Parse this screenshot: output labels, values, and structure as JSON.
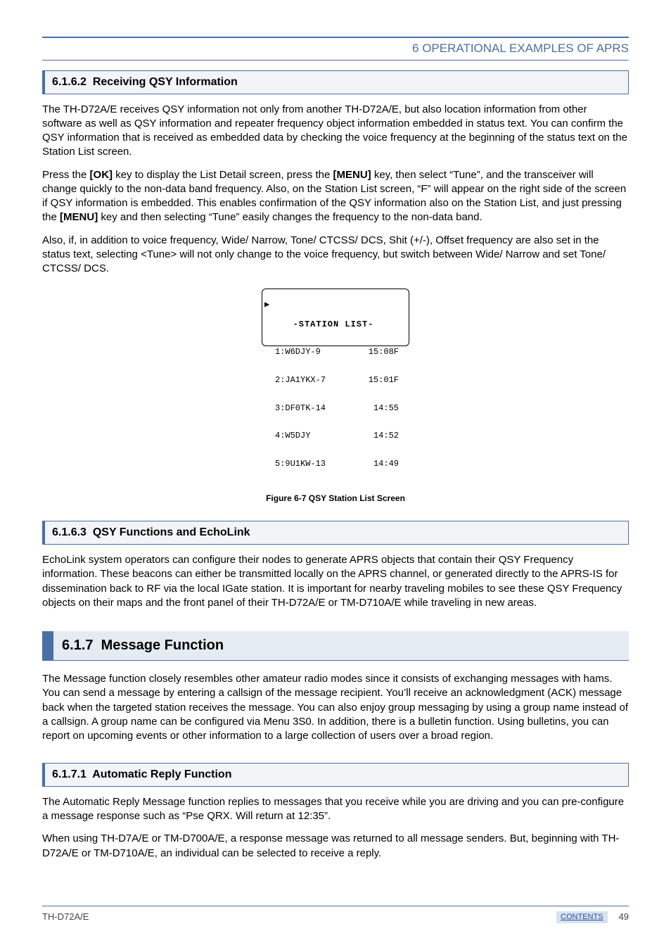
{
  "header": {
    "chapter": "6 OPERATIONAL EXAMPLES OF APRS"
  },
  "sec1": {
    "num": "6.1.6.2",
    "title": "Receiving QSY Information",
    "p1": "The TH-D72A/E receives QSY information not only from another TH-D72A/E, but also location information from other software as well as QSY information and repeater frequency object information embedded in status text.  You can confirm the QSY information that is received as embedded data by checking the voice frequency at the beginning of the status text on the Station List screen.",
    "p2_a": "Press the ",
    "p2_b": "[OK]",
    "p2_c": " key to display the List Detail screen, press the ",
    "p2_d": "[MENU]",
    "p2_e": " key, then select “Tune”, and the transceiver will change quickly to the non-data band frequency.  Also, on the Station List screen, “F” will appear on the right side of the screen if QSY information is embedded.  This enables confirmation of the QSY information also on the Station List, and just pressing the ",
    "p2_f": "[MENU]",
    "p2_g": " key and then selecting “Tune” easily changes the frequency to the non-data band.",
    "p3": "Also, if, in addition to voice frequency, Wide/ Narrow, Tone/ CTCSS/ DCS, Shit (+/-), Offset frequency are also set in the status text, selecting <Tune> will not only change to the voice frequency, but switch between Wide/ Narrow and set Tone/ CTCSS/ DCS."
  },
  "fig": {
    "title": "-STATION LIST-",
    "rows": [
      {
        "l": "1:W6DJY-9",
        "r": "15:08F"
      },
      {
        "l": "2:JA1YKX-7",
        "r": "15:01F"
      },
      {
        "l": "3:DF0TK-14",
        "r": "14:55"
      },
      {
        "l": "4:W5DJY",
        "r": "14:52"
      },
      {
        "l": "5:9U1KW-13",
        "r": "14:49"
      }
    ],
    "caption": "Figure 6-7  QSY Station List Screen"
  },
  "sec2": {
    "num": "6.1.6.3",
    "title": "QSY Functions and EchoLink",
    "p1": "EchoLink system operators can configure their nodes to generate APRS objects that contain their QSY Frequency information.  These beacons can either be transmitted locally on the APRS channel, or generated directly to the APRS-IS for dissemination back to RF via the local IGate station.  It is important for nearby traveling mobiles to see these QSY Frequency objects on their maps and the front panel of their TH-D72A/E or TM-D710A/E while traveling in new areas."
  },
  "sec3": {
    "num": "6.1.7",
    "title": "Message Function",
    "p1": "The Message function closely resembles other amateur radio modes since it consists of exchanging messages with hams.  You can send a message by entering a callsign of the message recipient.  You’ll receive an acknowledgment (ACK) message back when the targeted station receives the message.  You can also enjoy group messaging by using a group name instead of a callsign.  A group name can be configured via Menu 3S0.  In addition, there is a bulletin function.  Using bulletins, you can report on upcoming events or other information to a large collection of users over a broad region."
  },
  "sec4": {
    "num": "6.1.7.1",
    "title": "Automatic Reply Function",
    "p1": "The Automatic Reply Message function replies to messages that you receive while you are driving and you can pre-configure a message response such as “Pse QRX.  Will return at 12:35”.",
    "p2": "When using TH-D7A/E or TM-D700A/E, a response message was returned to all message senders.  But, beginning with TH-D72A/E or TM-D710A/E, an individual can be selected to receive a reply."
  },
  "footer": {
    "model": "TH-D72A/E",
    "contents": "CONTENTS",
    "page": "49"
  }
}
